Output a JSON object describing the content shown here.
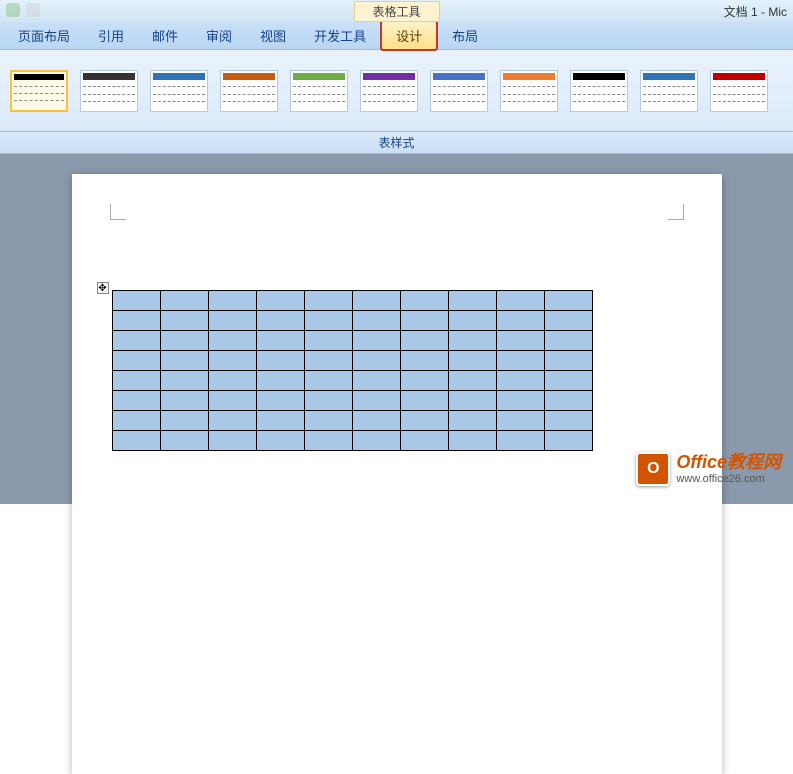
{
  "title_bar": {
    "contextual_label": "表格工具",
    "doc_title": "文档 1 - Mic"
  },
  "ribbon_tabs": [
    {
      "label": "页面布局"
    },
    {
      "label": "引用"
    },
    {
      "label": "邮件"
    },
    {
      "label": "审阅"
    },
    {
      "label": "视图"
    },
    {
      "label": "开发工具"
    },
    {
      "label": "设计",
      "active": true
    },
    {
      "label": "布局"
    }
  ],
  "style_gallery": {
    "group_label": "表样式",
    "styles": [
      {
        "header_color": "#000000",
        "selected": true
      },
      {
        "header_color": "#333333"
      },
      {
        "header_color": "#2e74b5"
      },
      {
        "header_color": "#c55a11"
      },
      {
        "header_color": "#70ad47"
      },
      {
        "header_color": "#7030a0"
      },
      {
        "header_color": "#4472c4"
      },
      {
        "header_color": "#ed7d31"
      },
      {
        "header_color": "#000000"
      },
      {
        "header_color": "#2e74b5"
      },
      {
        "header_color": "#c00000"
      }
    ]
  },
  "table": {
    "rows": 8,
    "cols": 10,
    "cell_bg": "#a9c8e8"
  },
  "table_anchor_glyph": "✥",
  "watermark": {
    "logo_letter": "O",
    "line1": "Office教程网",
    "line2": "www.office26.com"
  }
}
